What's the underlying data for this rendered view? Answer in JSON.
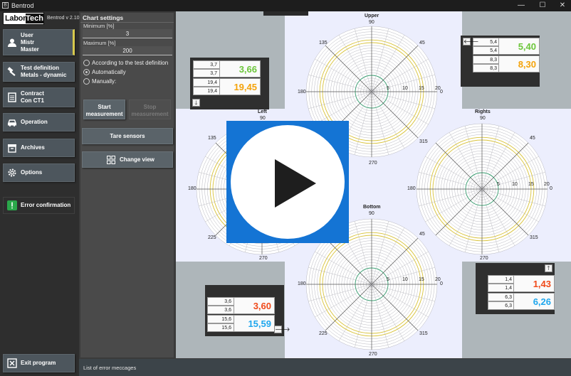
{
  "window": {
    "title": "Bentrod",
    "minimize": "—",
    "maximize": "☐",
    "close": "✕"
  },
  "logo": {
    "labor": "Labor",
    "tech": "Tech"
  },
  "version": "Bentrod v 2.10",
  "sidebar": {
    "user": {
      "line1": "User",
      "line2": "Mistr",
      "line3": "Master"
    },
    "test_definition": {
      "line1": "Test definition",
      "line2": "Metals - dynamic"
    },
    "contract": {
      "line1": "Contract",
      "line2": "Con CT1"
    },
    "operation": "Operation",
    "archives": "Archives",
    "options": "Options",
    "error_confirmation": "Error confirmation",
    "exit": "Exit program"
  },
  "chart_settings": {
    "title": "Chart settings",
    "minimum_label": "Minimum [%]",
    "minimum_value": "3",
    "maximum_label": "Maximum [%]",
    "maximum_value": "200",
    "options": [
      "According to the test definition",
      "Automatically",
      "Manually:"
    ],
    "selected": "Automatically",
    "start_button": "Start measurement",
    "stop_button": "Stop measurement",
    "tare_button": "Tare sensors",
    "change_view_button": "Change view"
  },
  "diagrams": {
    "upper": "Upper",
    "left": "Left",
    "rights": "Rights",
    "bottom": "Bottom",
    "angles": {
      "a90": "90",
      "a45": "45",
      "a135": "135",
      "a180": "180",
      "a0": "0",
      "a225": "225",
      "a270": "270",
      "a315": "315"
    },
    "radials": {
      "r5": "5",
      "r10": "10",
      "r15": "15",
      "r20": "20"
    }
  },
  "readouts": {
    "top_left": {
      "cells": [
        "3,7",
        "3,7",
        "19,4",
        "19,4"
      ],
      "big1": "3,66",
      "big2": "19,45",
      "big1_color": "#6cc63a",
      "big2_color": "#f4a30b",
      "arrow": "🡓"
    },
    "top_right": {
      "cells": [
        "5,4",
        "5,4",
        "8,3",
        "8,3"
      ],
      "big1": "5,40",
      "big2": "8,30",
      "big1_color": "#6cc63a",
      "big2_color": "#f4a30b",
      "arrow": "🡐"
    },
    "bottom_left": {
      "cells": [
        "3,6",
        "3,6",
        "15,6",
        "15,6"
      ],
      "big1": "3,60",
      "big2": "15,59",
      "big1_color": "#f04a1a",
      "big2_color": "#1fa7ee",
      "arrow": "🡒"
    },
    "bottom_right": {
      "cells": [
        "1,4",
        "1,4",
        "6,3",
        "6,3"
      ],
      "big1": "1,43",
      "big2": "6,26",
      "big1_color": "#f04a1a",
      "big2_color": "#1fa7ee",
      "arrow": "🡑"
    }
  },
  "statusbar": {
    "text": "List of error meccages"
  }
}
